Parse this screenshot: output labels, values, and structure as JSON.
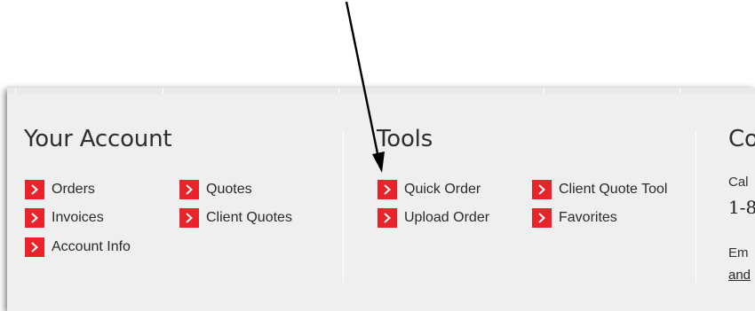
{
  "account": {
    "heading": "Your Account",
    "links": [
      "Orders",
      "Quotes",
      "Invoices",
      "Client Quotes",
      "Account Info"
    ]
  },
  "tools": {
    "heading": "Tools",
    "links": [
      "Quick Order",
      "Client Quote Tool",
      "Upload Order",
      "Favorites"
    ]
  },
  "contact": {
    "heading_partial": "Co",
    "call_partial": "Cal",
    "phone_partial": "1-8",
    "email_partial": "Em",
    "email_link_partial": "and"
  },
  "icons": {
    "link_arrow": "chevron-right-icon",
    "annotation": "pointer-arrow-icon"
  },
  "colors": {
    "accent": "#e8232a",
    "panel_bg": "#efefef",
    "text": "#2e2e2e"
  }
}
